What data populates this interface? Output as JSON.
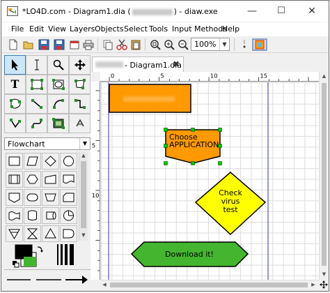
{
  "window": {
    "title_prefix": "*LO4D.com - Diagram1.dia (",
    "title_suffix": ") - diaw.exe",
    "minimize": "—",
    "maximize": "☐",
    "close": "✕"
  },
  "menu": {
    "items": [
      "File",
      "Edit",
      "View",
      "Layers",
      "Objects",
      "Select",
      "Tools",
      "Input Methods",
      "Help"
    ]
  },
  "toolbar": {
    "zoom_value": "100%"
  },
  "toolbox": {
    "sheet_name": "Flowchart"
  },
  "document_tab": {
    "label": " - Diagram1.dia",
    "close": "✖"
  },
  "ruler": {
    "h_ticks": [
      "0",
      "5",
      "10",
      "15"
    ],
    "v_ticks": [
      "5",
      "10"
    ]
  },
  "diagram": {
    "node_top_label": "",
    "node_choose_line1": "Choose",
    "node_choose_line2": "APPLICATION",
    "node_check_line1": "Check",
    "node_check_line2": "virus",
    "node_check_line3": "test",
    "node_download": "Download it!",
    "colors": {
      "orange": "#ff9900",
      "yellow": "#ffff00",
      "green": "#44b52e",
      "handle": "#00c800",
      "page_margin": "#3333aa"
    }
  }
}
